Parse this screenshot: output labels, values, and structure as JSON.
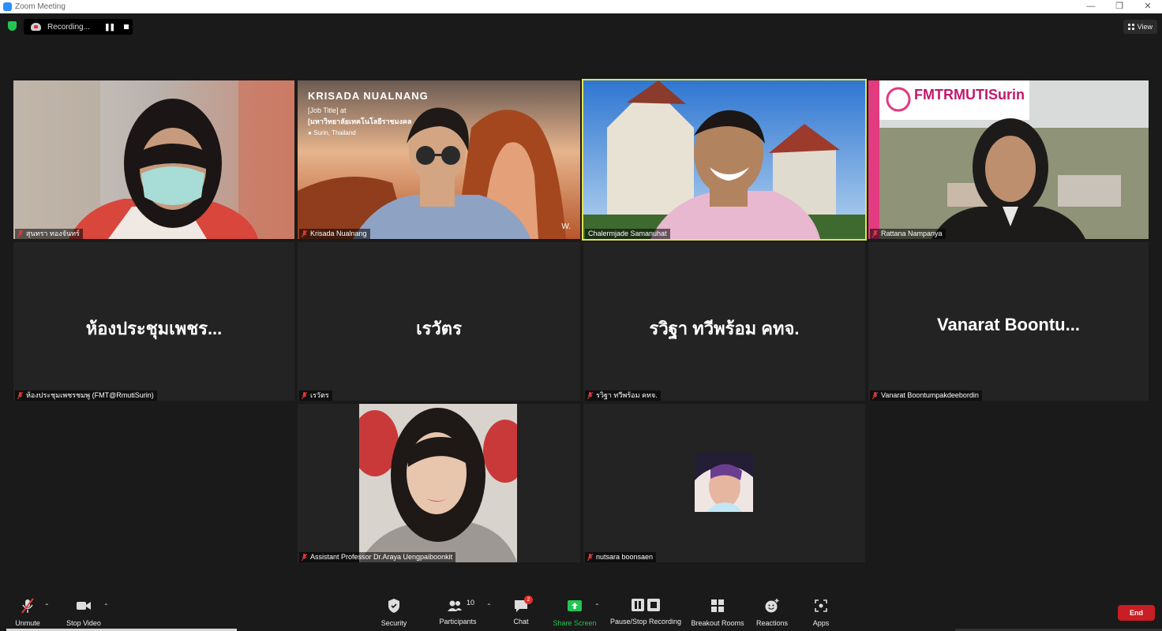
{
  "window": {
    "title": "Zoom Meeting"
  },
  "recording": {
    "label": "Recording..."
  },
  "view": {
    "label": "View"
  },
  "tiles": [
    {
      "name": "สุนทรา ทองจันทร์"
    },
    {
      "name": "Krisada Nualnang",
      "bg_title": "KRISADA NUALNANG",
      "bg_job": "[Job Title] at",
      "bg_org": "[มหาวิทยาลัยเทคโนโลยีราชมงคล",
      "bg_location": "Surin, Thailand",
      "bg_mark": "W."
    },
    {
      "name": "Chalermjade Samanuhat"
    },
    {
      "name": "Rattana Nampanya",
      "banner": "FMTRMUTISurin"
    },
    {
      "name": "ห้องประชุมเพชรชมพู (FMT@RmutiSurin)",
      "big": "ห้องประชุมเพชร..."
    },
    {
      "name": "เรวัตร",
      "big": "เรวัตร"
    },
    {
      "name": "รวิฐา ทวีพร้อม คทจ.",
      "big": "รวิฐา ทวีพร้อม คทจ."
    },
    {
      "name": "Vanarat Boontumpakdeebordin",
      "big": "Vanarat  Boontu..."
    },
    {
      "name": "Assistant Professor Dr.Araya Uengpaiboonkit"
    },
    {
      "name": "nutsara boonsaen"
    }
  ],
  "toolbar": {
    "unmute": "Unmute",
    "stop_video": "Stop Video",
    "security": "Security",
    "participants": "Participants",
    "participants_count": "10",
    "chat": "Chat",
    "chat_badge": "2",
    "share_screen": "Share Screen",
    "pause_stop_recording": "Pause/Stop Recording",
    "breakout_rooms": "Breakout Rooms",
    "reactions": "Reactions",
    "apps": "Apps",
    "end": "End"
  },
  "colors": {
    "share_green": "#23c552",
    "end_red": "#c81e24",
    "active_speaker": "#e2e25a"
  }
}
